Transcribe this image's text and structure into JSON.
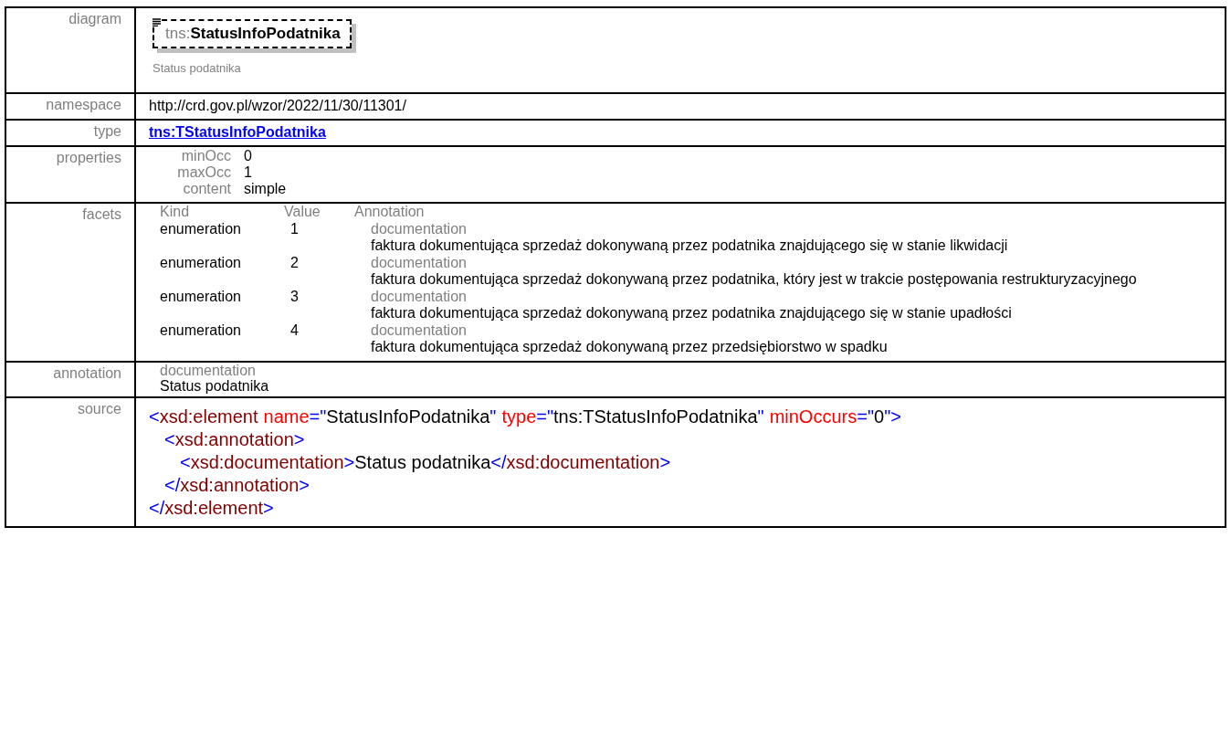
{
  "rows": [
    {
      "kind": "diagram",
      "label": "diagram",
      "prefix": "tns:",
      "name": "StatusInfoPodatnika",
      "caption": "Status podatnika"
    },
    {
      "kind": "text",
      "label": "namespace",
      "text": "http://crd.gov.pl/wzor/2022/11/30/11301/"
    },
    {
      "kind": "link",
      "label": "type",
      "text": "tns:TStatusInfoPodatnika"
    },
    {
      "kind": "properties",
      "label": "properties",
      "items": [
        {
          "name": "minOcc",
          "value": "0"
        },
        {
          "name": "maxOcc",
          "value": "1"
        },
        {
          "name": "content",
          "value": "simple"
        }
      ]
    },
    {
      "kind": "facets",
      "label": "facets",
      "columns": [
        "Kind",
        "Value",
        "Annotation"
      ],
      "items": [
        {
          "kind": "enumeration",
          "value": "1",
          "doc_label": "documentation",
          "doc": "faktura dokumentująca sprzedaż dokonywaną przez podatnika znajdującego się w stanie likwidacji"
        },
        {
          "kind": "enumeration",
          "value": "2",
          "doc_label": "documentation",
          "doc": "faktura dokumentująca sprzedaż dokonywaną przez podatnika, który jest w trakcie postępowania restrukturyzacyjnego"
        },
        {
          "kind": "enumeration",
          "value": "3",
          "doc_label": "documentation",
          "doc": "faktura dokumentująca sprzedaż dokonywaną przez podatnika znajdującego się w stanie upadłości"
        },
        {
          "kind": "enumeration",
          "value": "4",
          "doc_label": "documentation",
          "doc": "faktura dokumentująca sprzedaż dokonywaną przez przedsiębiorstwo w spadku"
        }
      ]
    },
    {
      "kind": "annotation",
      "label": "annotation",
      "doc_label": "documentation",
      "text": "Status podatnika"
    },
    {
      "kind": "source",
      "label": "source",
      "lines": [
        {
          "tokens": [
            {
              "kind": "punct",
              "text": "<"
            },
            {
              "kind": "tag",
              "text": "xsd:element"
            },
            {
              "kind": "attr",
              "text": "name"
            },
            {
              "kind": "punct",
              "text": "=\""
            },
            {
              "kind": "value",
              "text": "StatusInfoPodatnika"
            },
            {
              "kind": "punct",
              "text": "\""
            },
            {
              "kind": "attr",
              "text": "type"
            },
            {
              "kind": "punct",
              "text": "=\""
            },
            {
              "kind": "value",
              "text": "tns:TStatusInfoPodatnika"
            },
            {
              "kind": "punct",
              "text": "\""
            },
            {
              "kind": "attr",
              "text": "minOccurs"
            },
            {
              "kind": "punct",
              "text": "=\""
            },
            {
              "kind": "value",
              "text": "0"
            },
            {
              "kind": "punct",
              "text": "\">"
            }
          ],
          "children": [
            {
              "tokens": [
                {
                  "kind": "punct",
                  "text": "<"
                },
                {
                  "kind": "tag",
                  "text": "xsd:annotation"
                },
                {
                  "kind": "punct",
                  "text": ">"
                }
              ],
              "children": [
                {
                  "tokens": [
                    {
                      "kind": "punct",
                      "text": "<"
                    },
                    {
                      "kind": "tag",
                      "text": "xsd:documentation"
                    },
                    {
                      "kind": "punct",
                      "text": ">"
                    },
                    {
                      "kind": "value",
                      "text": "Status podatnika"
                    },
                    {
                      "kind": "punct",
                      "text": "</"
                    },
                    {
                      "kind": "tag",
                      "text": "xsd:documentation"
                    },
                    {
                      "kind": "punct",
                      "text": ">"
                    }
                  ]
                }
              ]
            },
            {
              "tokens": [
                {
                  "kind": "punct",
                  "text": "</"
                },
                {
                  "kind": "tag",
                  "text": "xsd:annotation"
                },
                {
                  "kind": "punct",
                  "text": ">"
                }
              ]
            }
          ]
        },
        {
          "tokens": [
            {
              "kind": "punct",
              "text": "</"
            },
            {
              "kind": "tag",
              "text": "xsd:element"
            },
            {
              "kind": "punct",
              "text": ">"
            }
          ]
        }
      ]
    }
  ]
}
